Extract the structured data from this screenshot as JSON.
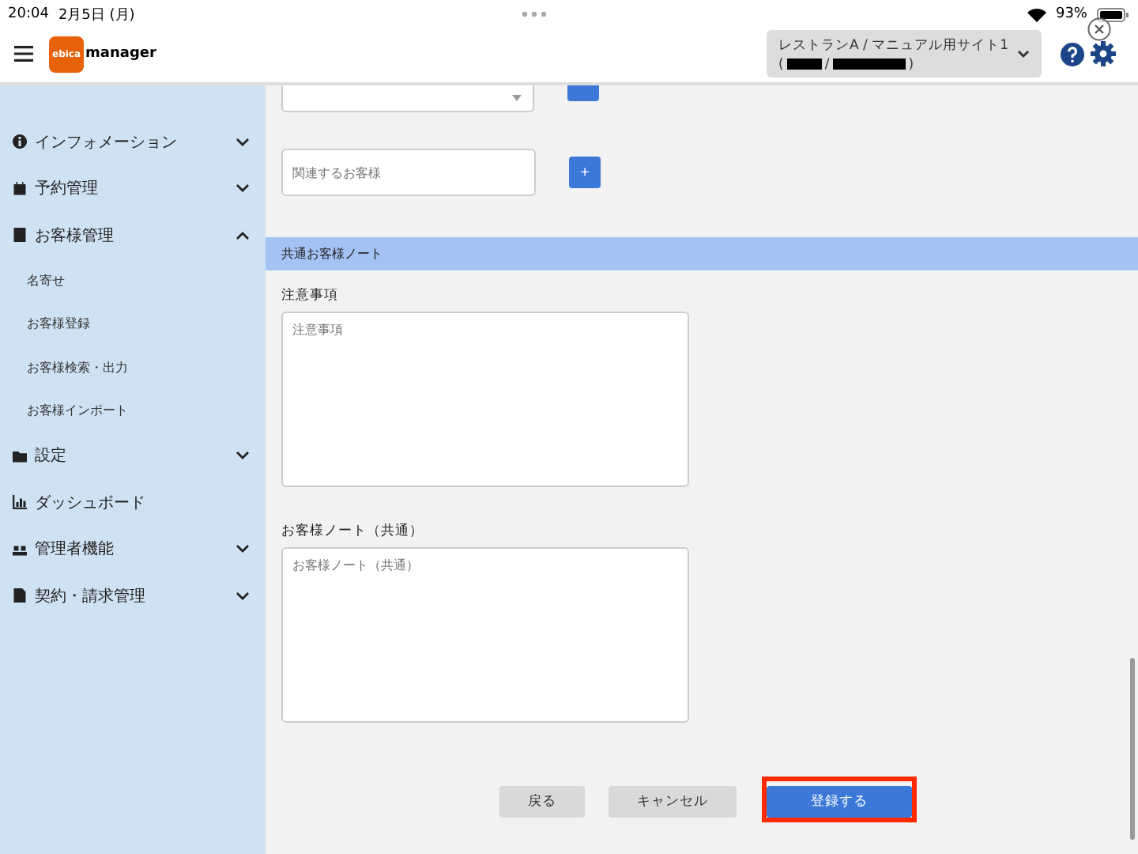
{
  "status_bar": {
    "time": "20:04",
    "date": "2月5日 (月)",
    "battery": "93%"
  },
  "header": {
    "logo_badge": "ebica",
    "logo_text": "manager",
    "site_selector": {
      "line1": "レストランA / マニュアル用サイト1",
      "line2_open": "(",
      "line2_sep": "/",
      "line2_close": ")"
    }
  },
  "sidebar": {
    "items": [
      {
        "label": "インフォメーション",
        "kind": "menu",
        "expanded": false
      },
      {
        "label": "予約管理",
        "kind": "menu",
        "expanded": false
      },
      {
        "label": "お客様管理",
        "kind": "menu",
        "expanded": true,
        "children": [
          {
            "label": "名寄せ"
          },
          {
            "label": "お客様登録"
          },
          {
            "label": "お客様検索・出力"
          },
          {
            "label": "お客様インポート"
          }
        ]
      },
      {
        "label": "設定",
        "kind": "menu",
        "expanded": false
      },
      {
        "label": "ダッシュボード",
        "kind": "link"
      },
      {
        "label": "管理者機能",
        "kind": "menu",
        "expanded": false
      },
      {
        "label": "契約・請求管理",
        "kind": "menu",
        "expanded": false
      }
    ]
  },
  "form": {
    "related_customer": {
      "placeholder": "関連するお客様",
      "add_button": "+"
    },
    "section_title": "共通お客様ノート",
    "fields": [
      {
        "label": "注意事項",
        "placeholder": "注意事項"
      },
      {
        "label": "お客様ノート（共通）",
        "placeholder": "お客様ノート（共通）"
      }
    ],
    "buttons": [
      {
        "label": "戻る",
        "kind": "secondary",
        "highlighted": false
      },
      {
        "label": "キャンセル",
        "kind": "secondary",
        "highlighted": false
      },
      {
        "label": "登録する",
        "kind": "primary",
        "highlighted": true
      }
    ]
  }
}
